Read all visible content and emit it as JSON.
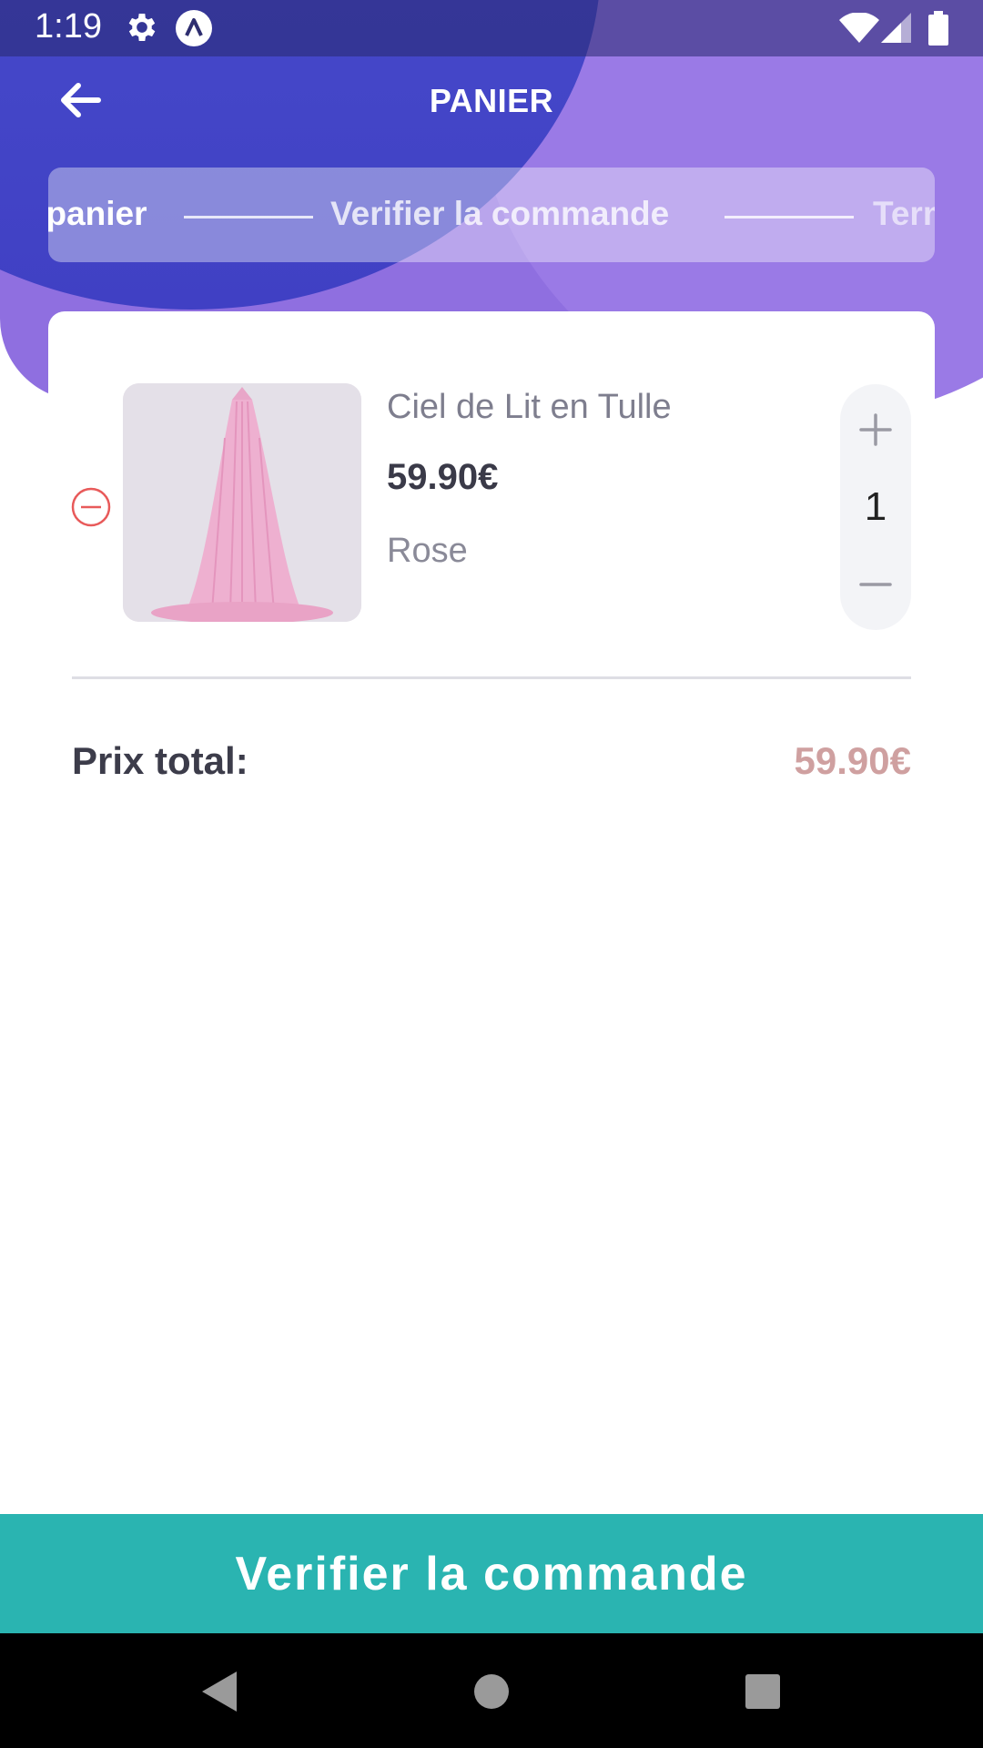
{
  "status_bar": {
    "time": "1:19",
    "icons": [
      "settings-icon",
      "app-logo-icon",
      "wifi-icon",
      "signal-icon",
      "battery-icon"
    ]
  },
  "app_bar": {
    "title": "PANIER",
    "back_icon": "arrow-left-icon"
  },
  "stepper": {
    "steps": [
      "Mon panier",
      "Verifier la commande",
      "Terminer"
    ],
    "visible_text": [
      "on panier",
      "Verifier la commande",
      "Termin"
    ]
  },
  "cart": {
    "items": [
      {
        "name": "Ciel de Lit en Tulle",
        "price": "59.90€",
        "variant": "Rose",
        "quantity": "1"
      }
    ],
    "total_label": "Prix total:",
    "total_value": "59.90€"
  },
  "cta": {
    "label": "Verifier la commande"
  },
  "colors": {
    "header_dark": "#4040c4",
    "header_light": "#9a7ae6",
    "cta": "#2ab4b1",
    "total_value": "#cfa0a0",
    "remove": "#e85a5a"
  },
  "navbar": {
    "icons": [
      "back-triangle-icon",
      "home-circle-icon",
      "recents-square-icon"
    ]
  }
}
